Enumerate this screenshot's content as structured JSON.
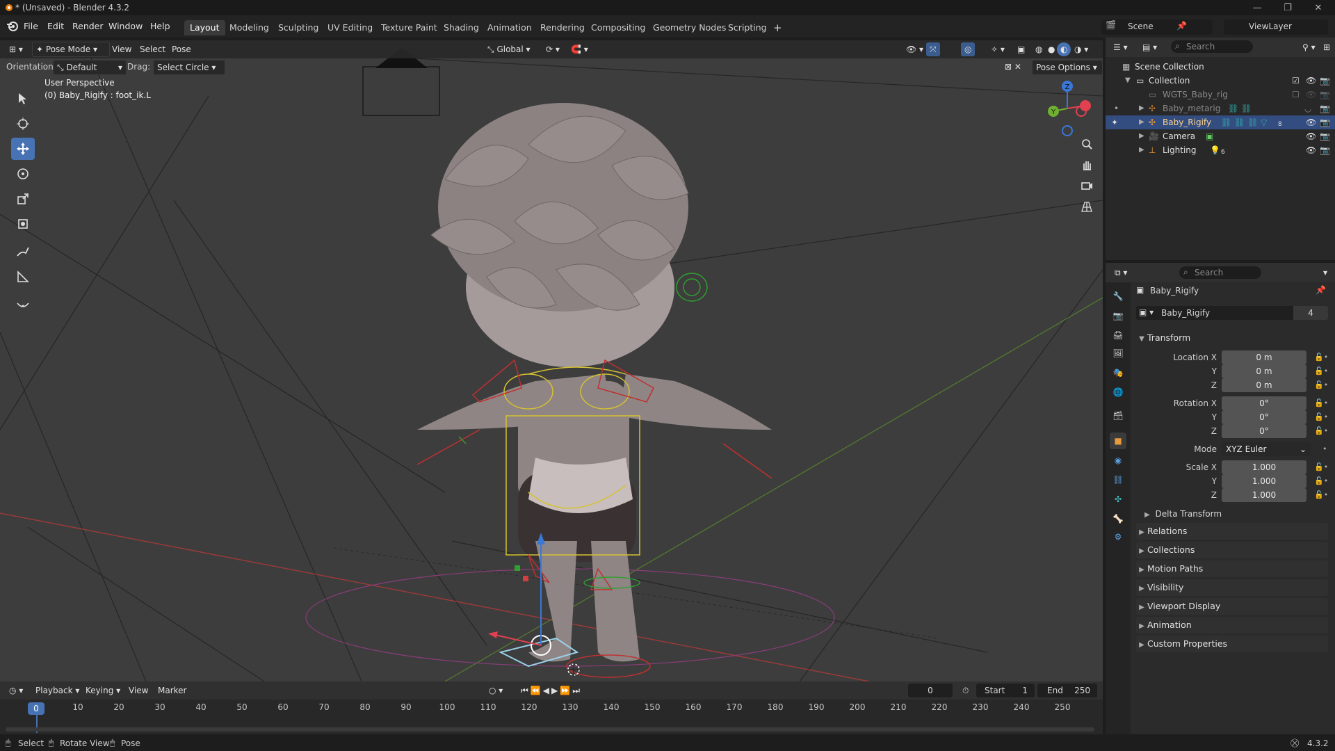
{
  "window": {
    "title": "* (Unsaved) - Blender 4.3.2"
  },
  "menu": {
    "file": "File",
    "edit": "Edit",
    "render": "Render",
    "window": "Window",
    "help": "Help"
  },
  "workspaces": [
    "Layout",
    "Modeling",
    "Sculpting",
    "UV Editing",
    "Texture Paint",
    "Shading",
    "Animation",
    "Rendering",
    "Compositing",
    "Geometry Nodes",
    "Scripting"
  ],
  "scene": {
    "label": "Scene",
    "view_layer": "ViewLayer"
  },
  "viewport_header": {
    "mode": "Pose Mode",
    "view": "View",
    "select": "Select",
    "pose": "Pose",
    "transform_orientation": "Global"
  },
  "tool_header": {
    "orientation_label": "Orientation:",
    "orientation_value": "Default",
    "drag_label": "Drag:",
    "drag_value": "Select Circle",
    "pose_options": "Pose Options"
  },
  "viewport_info": {
    "perspective": "User Perspective",
    "object": "(0) Baby_Rigify : foot_ik.L"
  },
  "gizmo": {
    "z": "Z",
    "y": "Y"
  },
  "outliner": {
    "search_placeholder": "Search",
    "scene_collection": "Scene Collection",
    "collection": "Collection",
    "items": [
      {
        "name": "WGTS_Baby_rig"
      },
      {
        "name": "Baby_metarig"
      },
      {
        "name": "Baby_Rigify",
        "badge": "8"
      },
      {
        "name": "Camera"
      },
      {
        "name": "Lighting",
        "badge": "6"
      }
    ]
  },
  "properties": {
    "search_placeholder": "Search",
    "object_name": "Baby_Rigify",
    "datablock_name": "Baby_Rigify",
    "datablock_users": "4",
    "transform": {
      "title": "Transform",
      "location_label": "Location X",
      "location": [
        "0 m",
        "0 m",
        "0 m"
      ],
      "rotation_label": "Rotation X",
      "rotation": [
        "0°",
        "0°",
        "0°"
      ],
      "mode_label": "Mode",
      "mode_value": "XYZ Euler",
      "scale_label": "Scale X",
      "scale": [
        "1.000",
        "1.000",
        "1.000"
      ],
      "y": "Y",
      "z": "Z",
      "delta": "Delta Transform"
    },
    "panels": [
      "Relations",
      "Collections",
      "Motion Paths",
      "Visibility",
      "Viewport Display",
      "Animation",
      "Custom Properties"
    ]
  },
  "timeline": {
    "playback": "Playback",
    "keying": "Keying",
    "view": "View",
    "marker": "Marker",
    "current_frame": "0",
    "start_label": "Start",
    "start": "1",
    "end_label": "End",
    "end": "250",
    "frame_marker": "0",
    "frame_ticks": [
      "10",
      "20",
      "30",
      "40",
      "50",
      "60",
      "70",
      "80",
      "90",
      "100",
      "110",
      "120",
      "130",
      "140",
      "150",
      "160",
      "170",
      "180",
      "190",
      "200",
      "210",
      "220",
      "230",
      "240",
      "250"
    ]
  },
  "statusbar": {
    "select": "Select",
    "rotate": "Rotate View",
    "pose": "Pose",
    "version": "4.3.2"
  },
  "colors": {
    "accent": "#4772b3",
    "selected_row": "#334d80",
    "rig_yellow": "#d6c230",
    "axis_x": "#e04050",
    "axis_y": "#70b030",
    "axis_z": "#3a78d8"
  }
}
